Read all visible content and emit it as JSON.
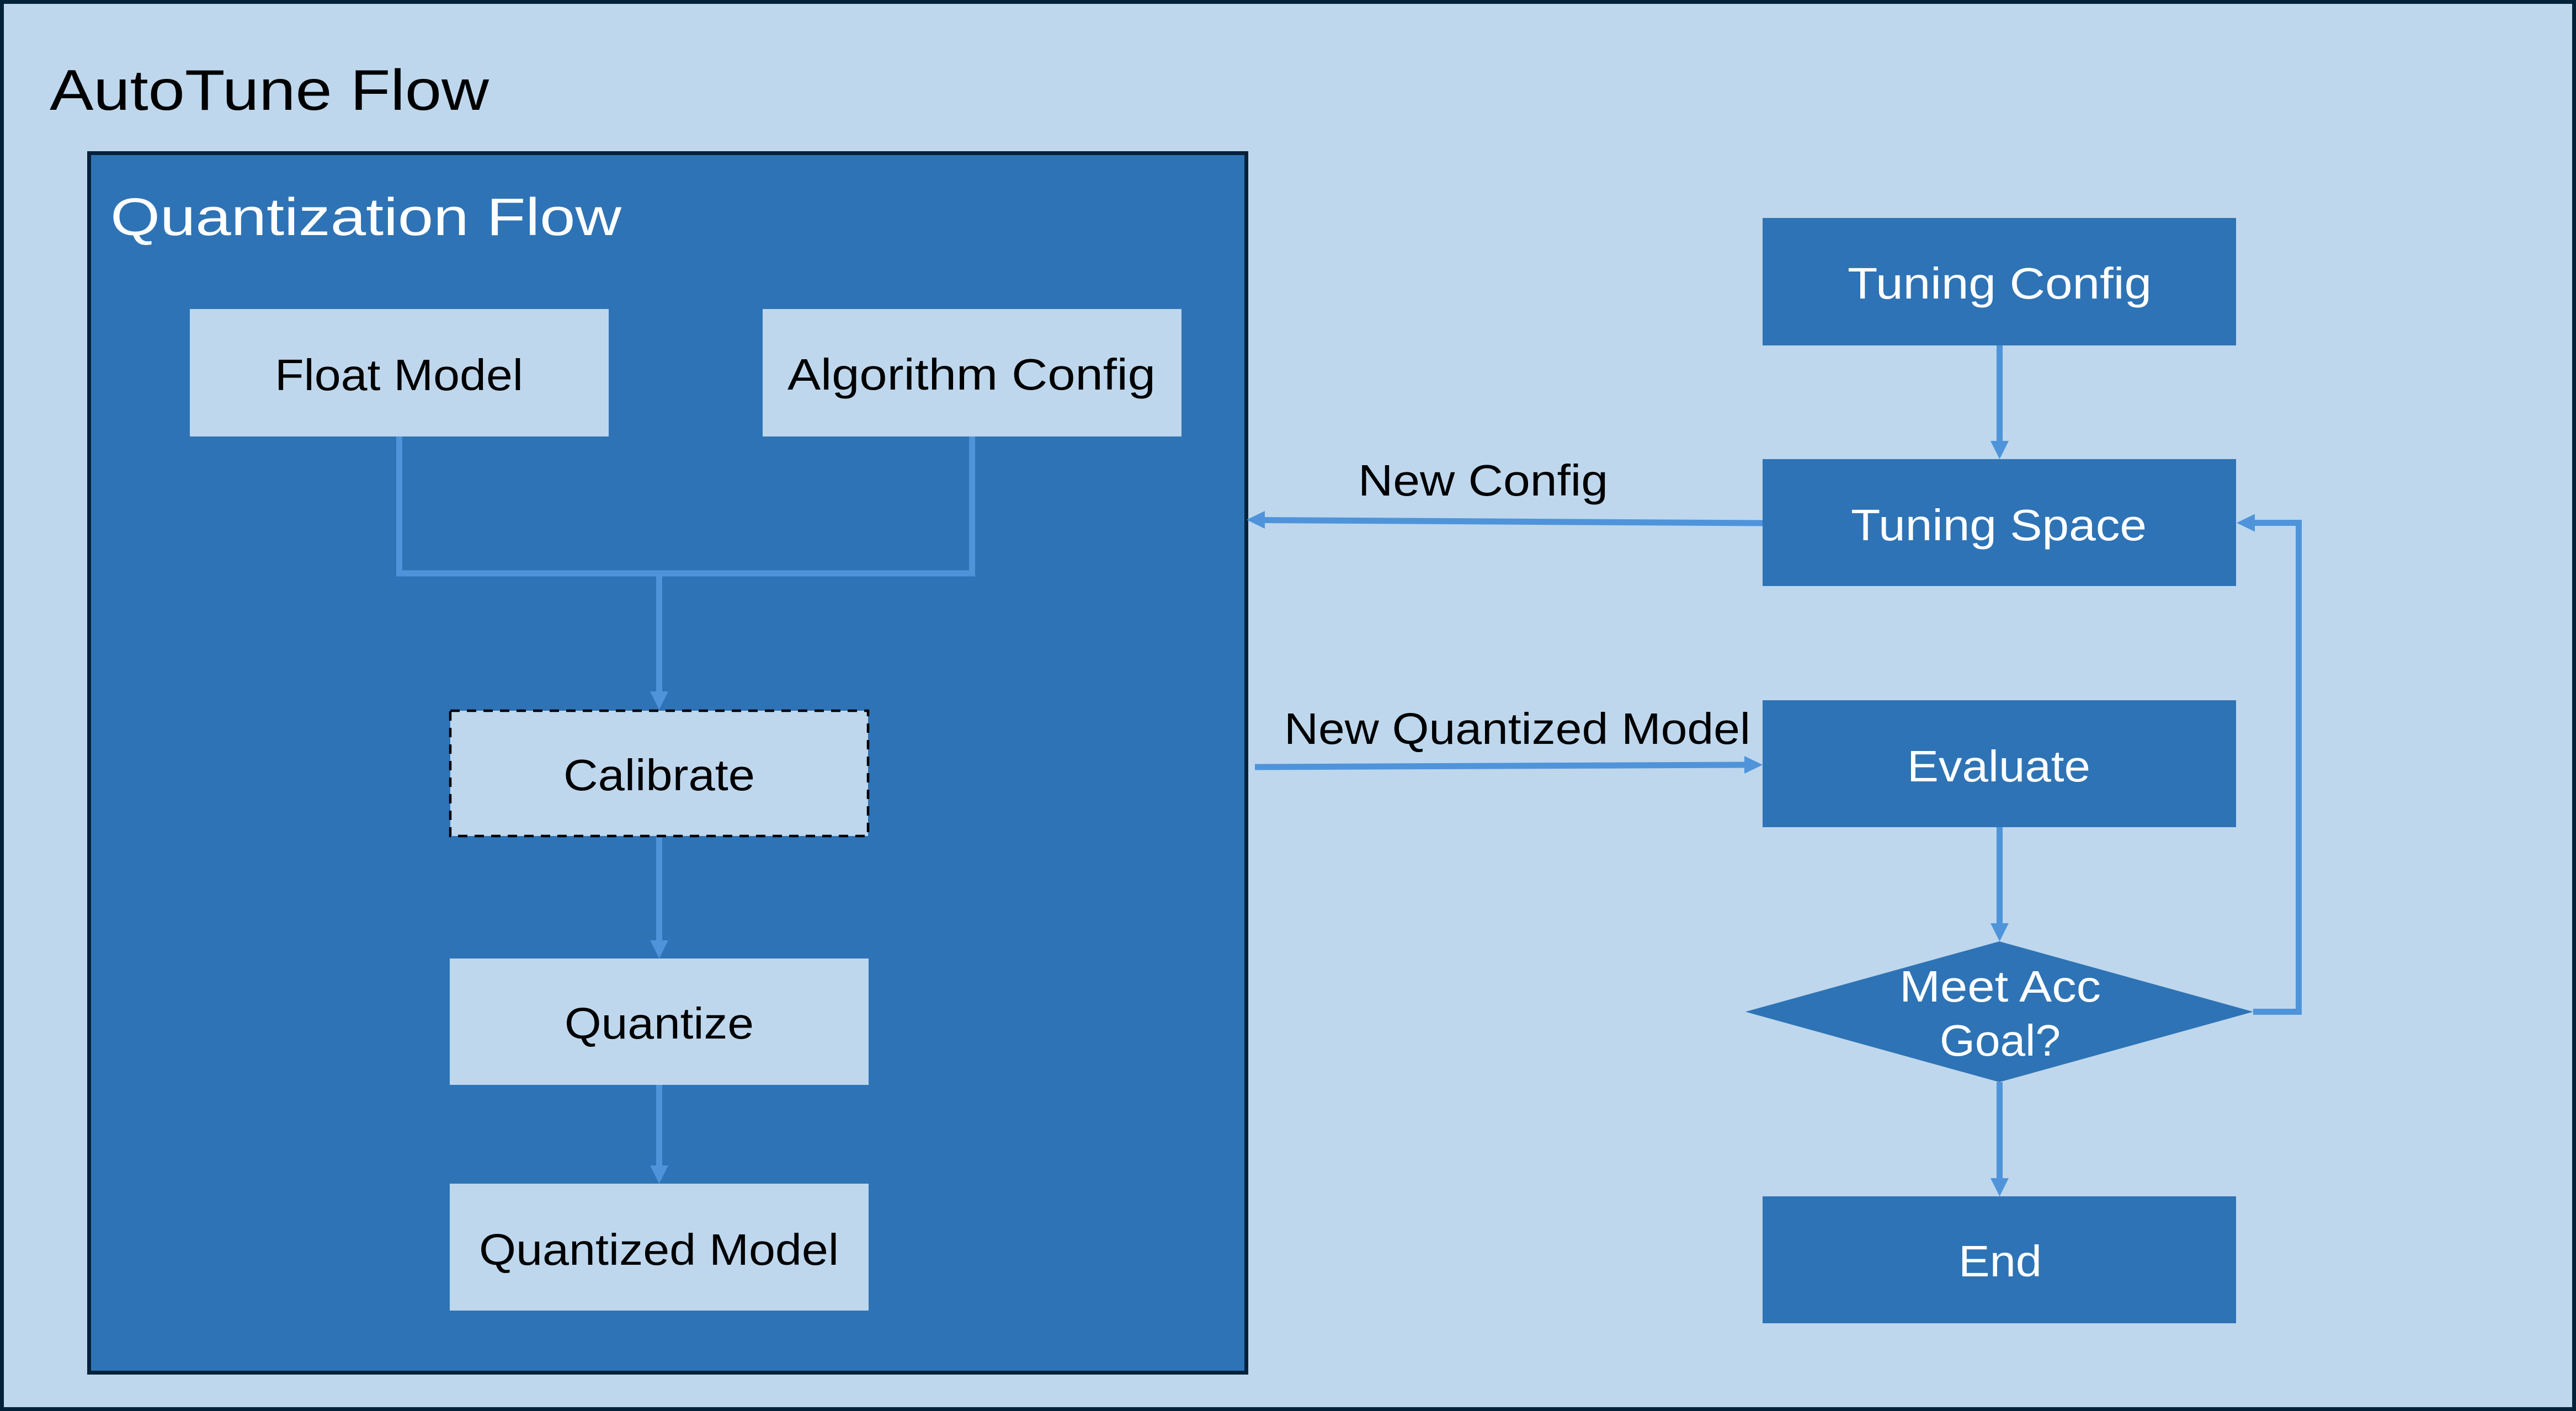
{
  "title": "AutoTune Flow",
  "quantization_flow": {
    "title": "Quantization Flow",
    "nodes": {
      "float_model": "Float Model",
      "algorithm_config": "Algorithm Config",
      "calibrate": "Calibrate",
      "quantize": "Quantize",
      "quantized_model": "Quantized Model"
    },
    "optional_step": "Calibrate"
  },
  "tuning_flow": {
    "nodes": {
      "tuning_config": "Tuning Config",
      "tuning_space": "Tuning Space",
      "evaluate": "Evaluate",
      "decision_line1": "Meet Acc",
      "decision_line2": "Goal?",
      "end": "End"
    }
  },
  "edges": {
    "new_config": "New Config",
    "new_quantized_model": "New Quantized Model"
  },
  "flow": [
    [
      "Float Model",
      "Calibrate"
    ],
    [
      "Algorithm Config",
      "Calibrate"
    ],
    [
      "Calibrate",
      "Quantize"
    ],
    [
      "Quantize",
      "Quantized Model"
    ],
    [
      "Tuning Config",
      "Tuning Space"
    ],
    [
      "Tuning Space",
      "Quantization Flow"
    ],
    [
      "Quantization Flow",
      "Evaluate"
    ],
    [
      "Evaluate",
      "Meet Acc Goal?"
    ],
    [
      "Meet Acc Goal?",
      "End"
    ],
    [
      "Meet Acc Goal?",
      "Tuning Space"
    ]
  ],
  "colors": {
    "frame": "#03223a",
    "background": "#bed7ed",
    "box_blue": "#2e73b5",
    "box_light": "#bed7ed",
    "connector": "#4f94da",
    "text_dark": "#000000",
    "text_light": "#ffffff"
  }
}
